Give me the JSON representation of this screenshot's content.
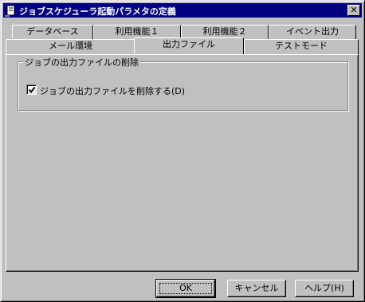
{
  "window": {
    "title": "ジョブスケジューラ起動パラメタの定義",
    "close_label": "✕"
  },
  "tabs_row_back": [
    {
      "label": "データベース"
    },
    {
      "label": "利用機能１"
    },
    {
      "label": "利用機能２"
    },
    {
      "label": "イベント出力"
    }
  ],
  "tabs_row_front": [
    {
      "label": "メール環境"
    },
    {
      "label": "出力ファイル",
      "active": true
    },
    {
      "label": "テストモード"
    }
  ],
  "group": {
    "title": "ジョブの出力ファイルの削除",
    "checkbox": {
      "label": "ジョブの出力ファイルを削除する(D)",
      "checked": true
    }
  },
  "buttons": {
    "ok": "OK",
    "cancel": "キャンセル",
    "help": "ヘルプ(H)"
  }
}
